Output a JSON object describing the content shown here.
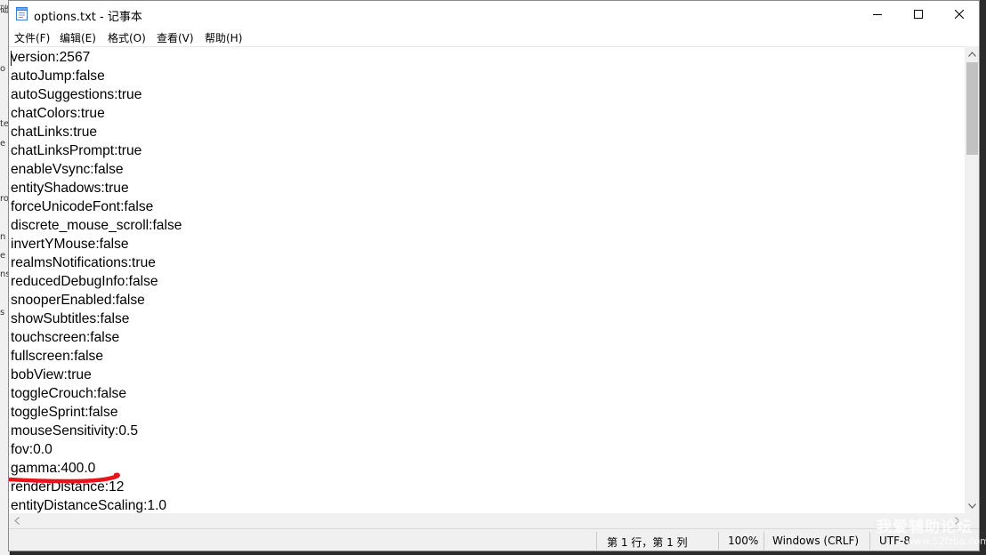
{
  "window": {
    "title": "options.txt - 记事本"
  },
  "menu": [
    {
      "label": "文件(F)"
    },
    {
      "label": "编辑(E)"
    },
    {
      "label": "格式(O)"
    },
    {
      "label": "查看(V)"
    },
    {
      "label": "帮助(H)"
    }
  ],
  "editor": {
    "lines": [
      "version:2567",
      "autoJump:false",
      "autoSuggestions:true",
      "chatColors:true",
      "chatLinks:true",
      "chatLinksPrompt:true",
      "enableVsync:false",
      "entityShadows:true",
      "forceUnicodeFont:false",
      "discrete_mouse_scroll:false",
      "invertYMouse:false",
      "realmsNotifications:true",
      "reducedDebugInfo:false",
      "snooperEnabled:false",
      "showSubtitles:false",
      "touchscreen:false",
      "fullscreen:false",
      "bobView:true",
      "toggleCrouch:false",
      "toggleSprint:false",
      "mouseSensitivity:0.5",
      "fov:0.0",
      "gamma:400.0",
      "renderDistance:12",
      "entityDistanceScaling:1.0"
    ],
    "highlighted_line": "gamma:400.0",
    "highlight_color": "#e8141b"
  },
  "statusbar": {
    "position": "第 1 行，第 1 列",
    "zoom": "100%",
    "line_ending": "Windows (CRLF)",
    "encoding": "UTF-8"
  },
  "background_window_fragments": [
    "础",
    "o",
    "te",
    "e",
    "ro",
    "n",
    "e",
    "ns",
    "s"
  ],
  "watermark": {
    "text": "我爱辅助论坛",
    "url": "www.52fzba.com"
  }
}
